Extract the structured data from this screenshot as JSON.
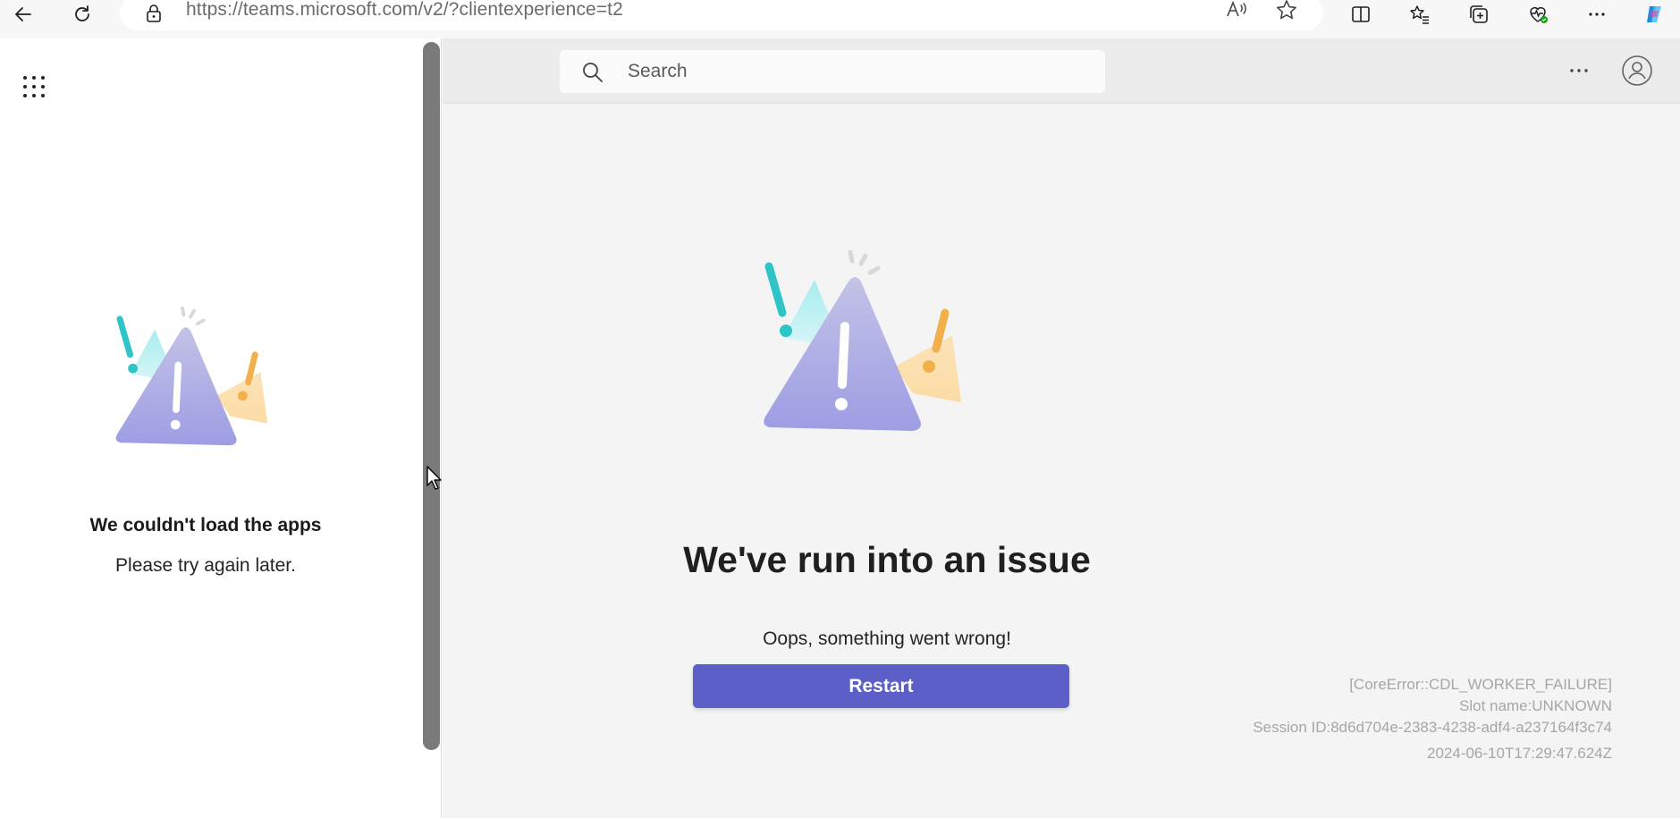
{
  "browser": {
    "url_host": "https://teams.microsoft.com",
    "url_path": "/v2/?clientexperience=t2",
    "icons": [
      "back-arrow-icon",
      "refresh-icon",
      "lock-icon",
      "read-aloud-icon",
      "favorite-star-icon",
      "split-screen-icon",
      "favorites-icon",
      "collections-icon",
      "browser-essentials-icon",
      "more-icon",
      "copilot-icon"
    ]
  },
  "left_panel": {
    "title": "We couldn't load the apps",
    "subtitle": "Please try again later."
  },
  "header": {
    "search_placeholder": "Search"
  },
  "error": {
    "title": "We've run into an issue",
    "message": "Oops, something went wrong!",
    "button_label": "Restart",
    "code": "[CoreError::CDL_WORKER_FAILURE]",
    "slot": "Slot name:UNKNOWN",
    "session": "Session ID:8d6d704e-2383-4238-adf4-a237164f3c74",
    "timestamp": "2024-06-10T17:29:47.624Z"
  },
  "colors": {
    "accent": "#5b5fc7",
    "warning_teal": "#2ec4c8",
    "warning_orange": "#f2b04b",
    "warning_purple": "#9b9ce6"
  }
}
